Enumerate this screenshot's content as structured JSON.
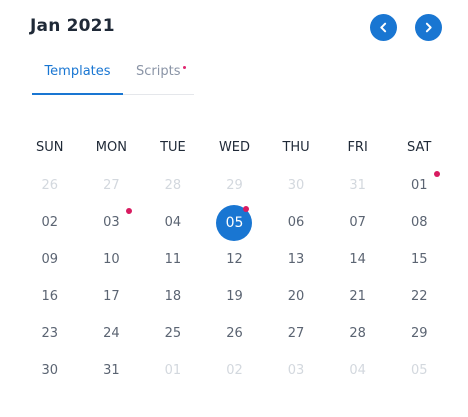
{
  "header": {
    "month_label": "Jan 2021"
  },
  "tabs": [
    {
      "label": "Templates",
      "active": true,
      "has_dot": false
    },
    {
      "label": "Scripts",
      "active": false,
      "has_dot": true
    }
  ],
  "colors": {
    "accent": "#1976d2",
    "event_dot": "#d81b60"
  },
  "icons": {
    "prev": "chevron-left-icon",
    "next": "chevron-right-icon"
  },
  "weekdays": [
    "SUN",
    "MON",
    "TUE",
    "WED",
    "THU",
    "FRI",
    "SAT"
  ],
  "days": [
    {
      "label": "26",
      "in_month": false
    },
    {
      "label": "27",
      "in_month": false
    },
    {
      "label": "28",
      "in_month": false
    },
    {
      "label": "29",
      "in_month": false
    },
    {
      "label": "30",
      "in_month": false
    },
    {
      "label": "31",
      "in_month": false
    },
    {
      "label": "01",
      "in_month": true,
      "event": true
    },
    {
      "label": "02",
      "in_month": true
    },
    {
      "label": "03",
      "in_month": true,
      "event": true
    },
    {
      "label": "04",
      "in_month": true
    },
    {
      "label": "05",
      "in_month": true,
      "selected": true,
      "event": true
    },
    {
      "label": "06",
      "in_month": true
    },
    {
      "label": "07",
      "in_month": true
    },
    {
      "label": "08",
      "in_month": true
    },
    {
      "label": "09",
      "in_month": true
    },
    {
      "label": "10",
      "in_month": true
    },
    {
      "label": "11",
      "in_month": true
    },
    {
      "label": "12",
      "in_month": true
    },
    {
      "label": "13",
      "in_month": true
    },
    {
      "label": "14",
      "in_month": true
    },
    {
      "label": "15",
      "in_month": true
    },
    {
      "label": "16",
      "in_month": true
    },
    {
      "label": "17",
      "in_month": true
    },
    {
      "label": "18",
      "in_month": true
    },
    {
      "label": "19",
      "in_month": true
    },
    {
      "label": "20",
      "in_month": true
    },
    {
      "label": "21",
      "in_month": true
    },
    {
      "label": "22",
      "in_month": true
    },
    {
      "label": "23",
      "in_month": true
    },
    {
      "label": "24",
      "in_month": true
    },
    {
      "label": "25",
      "in_month": true
    },
    {
      "label": "26",
      "in_month": true
    },
    {
      "label": "27",
      "in_month": true
    },
    {
      "label": "28",
      "in_month": true
    },
    {
      "label": "29",
      "in_month": true
    },
    {
      "label": "30",
      "in_month": true
    },
    {
      "label": "31",
      "in_month": true
    },
    {
      "label": "01",
      "in_month": false
    },
    {
      "label": "02",
      "in_month": false
    },
    {
      "label": "03",
      "in_month": false
    },
    {
      "label": "04",
      "in_month": false
    },
    {
      "label": "05",
      "in_month": false
    }
  ]
}
